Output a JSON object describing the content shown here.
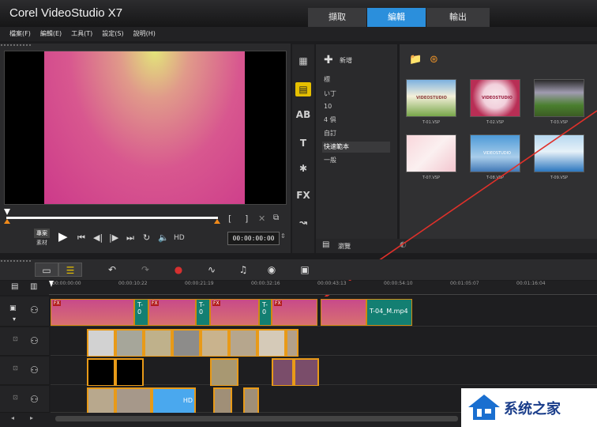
{
  "app": {
    "title": "Corel VideoStudio X7"
  },
  "mode_tabs": [
    "擷取",
    "編輯",
    "輸出"
  ],
  "menu": [
    "檔案(F)",
    "編輯(E)",
    "工具(T)",
    "設定(S)",
    "說明(H)"
  ],
  "preview": {
    "mode_labels": [
      "專案",
      "素材"
    ],
    "hd_label": "HD",
    "timecode": "00:00:00:00",
    "trim_brackets": [
      "[",
      "]"
    ]
  },
  "library": {
    "add_label": "新增",
    "folders": [
      "標",
      "い丁",
      "10",
      "4 俱",
      "自訂",
      "快速範本",
      "一般"
    ],
    "selected_folder": "快速範本",
    "thumbnails": [
      "T-01.VSP",
      "T-02.VSP",
      "T-03.VSP",
      "T-07.VSP",
      "T-08.VSP",
      "T-09.VSP"
    ],
    "thumbnail_texts": [
      "VIDEOSTUDIO",
      "VIDEOSTUDIO",
      "VIDEOSTUDIO"
    ],
    "bottom_label": "瀏覽"
  },
  "timeline": {
    "ruler_ticks": [
      "00:00:00:00",
      "00:00:10:22",
      "00:00:21:19",
      "00:00:32:16",
      "00:00:43:13",
      "00:00:54:10",
      "00:01:05:07",
      "00:01:16:04"
    ],
    "video_track": {
      "clip_titles": [
        "T-0",
        "T-0",
        "T-0",
        "T-04_M.mp4"
      ],
      "fx_badge": "FX"
    },
    "overlay_track_4_label": "HD"
  },
  "watermark": {
    "text": "系统之家"
  },
  "colors": {
    "accent": "#2b8fdc",
    "clip_border": "#e89a18",
    "library_active": "#e6c000",
    "clip_teal": "#137f72"
  }
}
